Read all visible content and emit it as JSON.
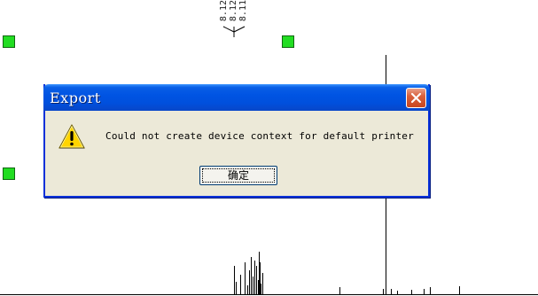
{
  "peak_labels": [
    "8.12",
    "8.12",
    "8.11"
  ],
  "dialog": {
    "title": "Export",
    "message": "Could not create device context for default printer",
    "ok_label": "确定",
    "icon": "warning-icon",
    "close_icon": "close-icon"
  },
  "colors": {
    "titlebar": "#0054e3",
    "dialog_bg": "#ece9d8",
    "close_button": "#d9603c",
    "handle": "#22dd22"
  }
}
